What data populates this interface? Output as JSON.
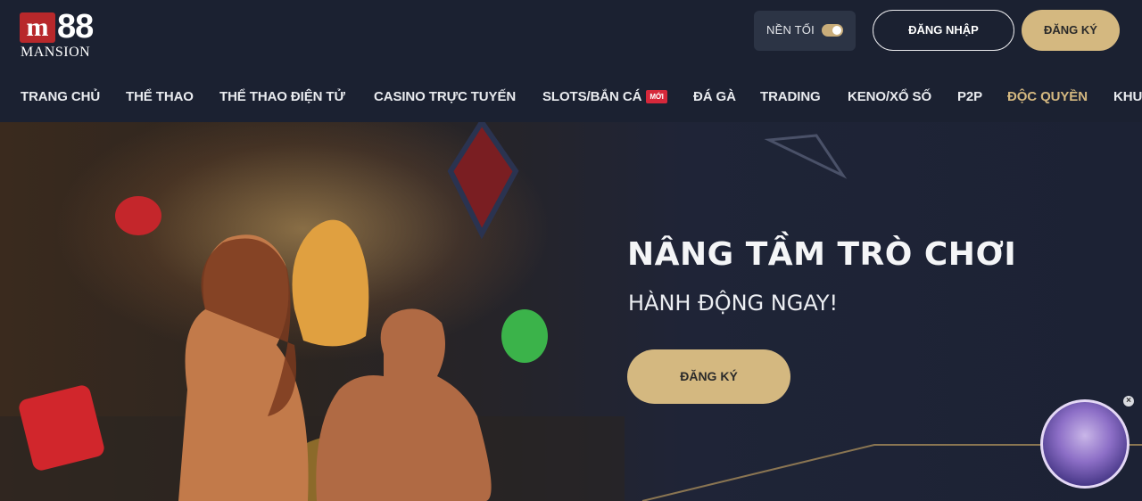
{
  "brand": {
    "logo_mark": "m",
    "logo_number": "88",
    "logo_word": "MANSION",
    "accent_color": "#d4b880",
    "logo_red": "#b8282b"
  },
  "header": {
    "theme_label": "NỀN TỐI",
    "login_label": "ĐĂNG NHẬP",
    "signup_label": "ĐĂNG KÝ"
  },
  "nav": {
    "items": [
      {
        "label": "TRANG CHỦ"
      },
      {
        "label": "THỂ THAO"
      },
      {
        "label": "THỂ THAO ĐIỆN TỬ"
      },
      {
        "label": "CASINO TRỰC TUYẾN"
      },
      {
        "label": "SLOTS/BẮN CÁ",
        "badge": "MỚI"
      },
      {
        "label": "ĐÁ GÀ"
      },
      {
        "label": "TRADING"
      },
      {
        "label": "KENO/XỔ SỐ"
      },
      {
        "label": "P2P"
      },
      {
        "label": "ĐỘC QUYỀN",
        "active": true
      },
      {
        "label": "KHU"
      }
    ]
  },
  "banner": {
    "title": "NÂNG TẦM TRÒ CHƠI",
    "subtitle": "HÀNH ĐỘNG NGAY!",
    "cta_label": "ĐĂNG KÝ"
  },
  "widget": {
    "close_symbol": "×"
  }
}
